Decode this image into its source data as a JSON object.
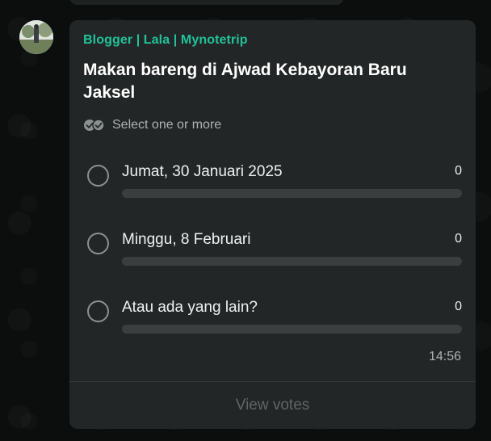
{
  "message": {
    "sender": "Blogger | Lala | Mynotetrip",
    "time": "14:56"
  },
  "poll": {
    "question": "Makan bareng di Ajwad Kebayoran Baru Jaksel",
    "select_hint": "Select one or more",
    "options": [
      {
        "label": "Jumat, 30 Januari 2025",
        "count": "0",
        "fraction": 0
      },
      {
        "label": "Minggu, 8 Februari",
        "count": "0",
        "fraction": 0
      },
      {
        "label": "Atau ada yang lain?",
        "count": "0",
        "fraction": 0
      }
    ],
    "view_votes_label": "View votes"
  },
  "colors": {
    "accent": "#21c29a",
    "bubble": "#232626",
    "background": "#0b0d0d",
    "text": "#ffffff",
    "muted": "#aeb3b2"
  },
  "icons": {
    "select_hint": "double-check-icon",
    "option": "radio-unchecked-icon"
  }
}
